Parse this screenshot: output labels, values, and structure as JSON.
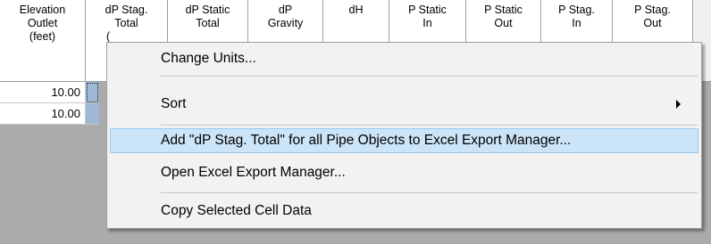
{
  "columns": [
    {
      "id": "elevation-outlet",
      "lines": [
        "Elevation",
        "Outlet",
        "(feet)"
      ]
    },
    {
      "id": "dp-stag-total",
      "lines": [
        "dP Stag.",
        "Total",
        "("
      ]
    },
    {
      "id": "dp-static-total",
      "lines": [
        "dP Static",
        "Total",
        ""
      ]
    },
    {
      "id": "dp-gravity",
      "lines": [
        "dP",
        "Gravity",
        ""
      ]
    },
    {
      "id": "dh",
      "lines": [
        "dH",
        "",
        ""
      ]
    },
    {
      "id": "p-static-in",
      "lines": [
        "P Static",
        "In",
        ""
      ]
    },
    {
      "id": "p-static-out",
      "lines": [
        "P Static",
        "Out",
        ""
      ]
    },
    {
      "id": "p-stag-in",
      "lines": [
        "P Stag.",
        "In",
        ""
      ]
    },
    {
      "id": "p-stag-out",
      "lines": [
        "P Stag.",
        "Out",
        ""
      ]
    }
  ],
  "rows": [
    {
      "elevation_outlet": "10.00"
    },
    {
      "elevation_outlet": "10.00"
    }
  ],
  "context_menu": {
    "items": [
      {
        "label": "Change Units...",
        "has_submenu": false,
        "highlighted": false
      },
      {
        "label": "Sort",
        "has_submenu": true,
        "highlighted": false
      },
      {
        "label": "Add \"dP Stag. Total\" for all Pipe Objects to Excel Export Manager...",
        "has_submenu": false,
        "highlighted": true
      },
      {
        "label": "Open Excel Export Manager...",
        "has_submenu": false,
        "highlighted": false
      },
      {
        "label": "Copy Selected Cell Data",
        "has_submenu": false,
        "highlighted": false
      }
    ]
  },
  "colors": {
    "selection": "#9fb8d6",
    "menu_highlight": "#cce4f7",
    "grid_background": "#ababab"
  }
}
